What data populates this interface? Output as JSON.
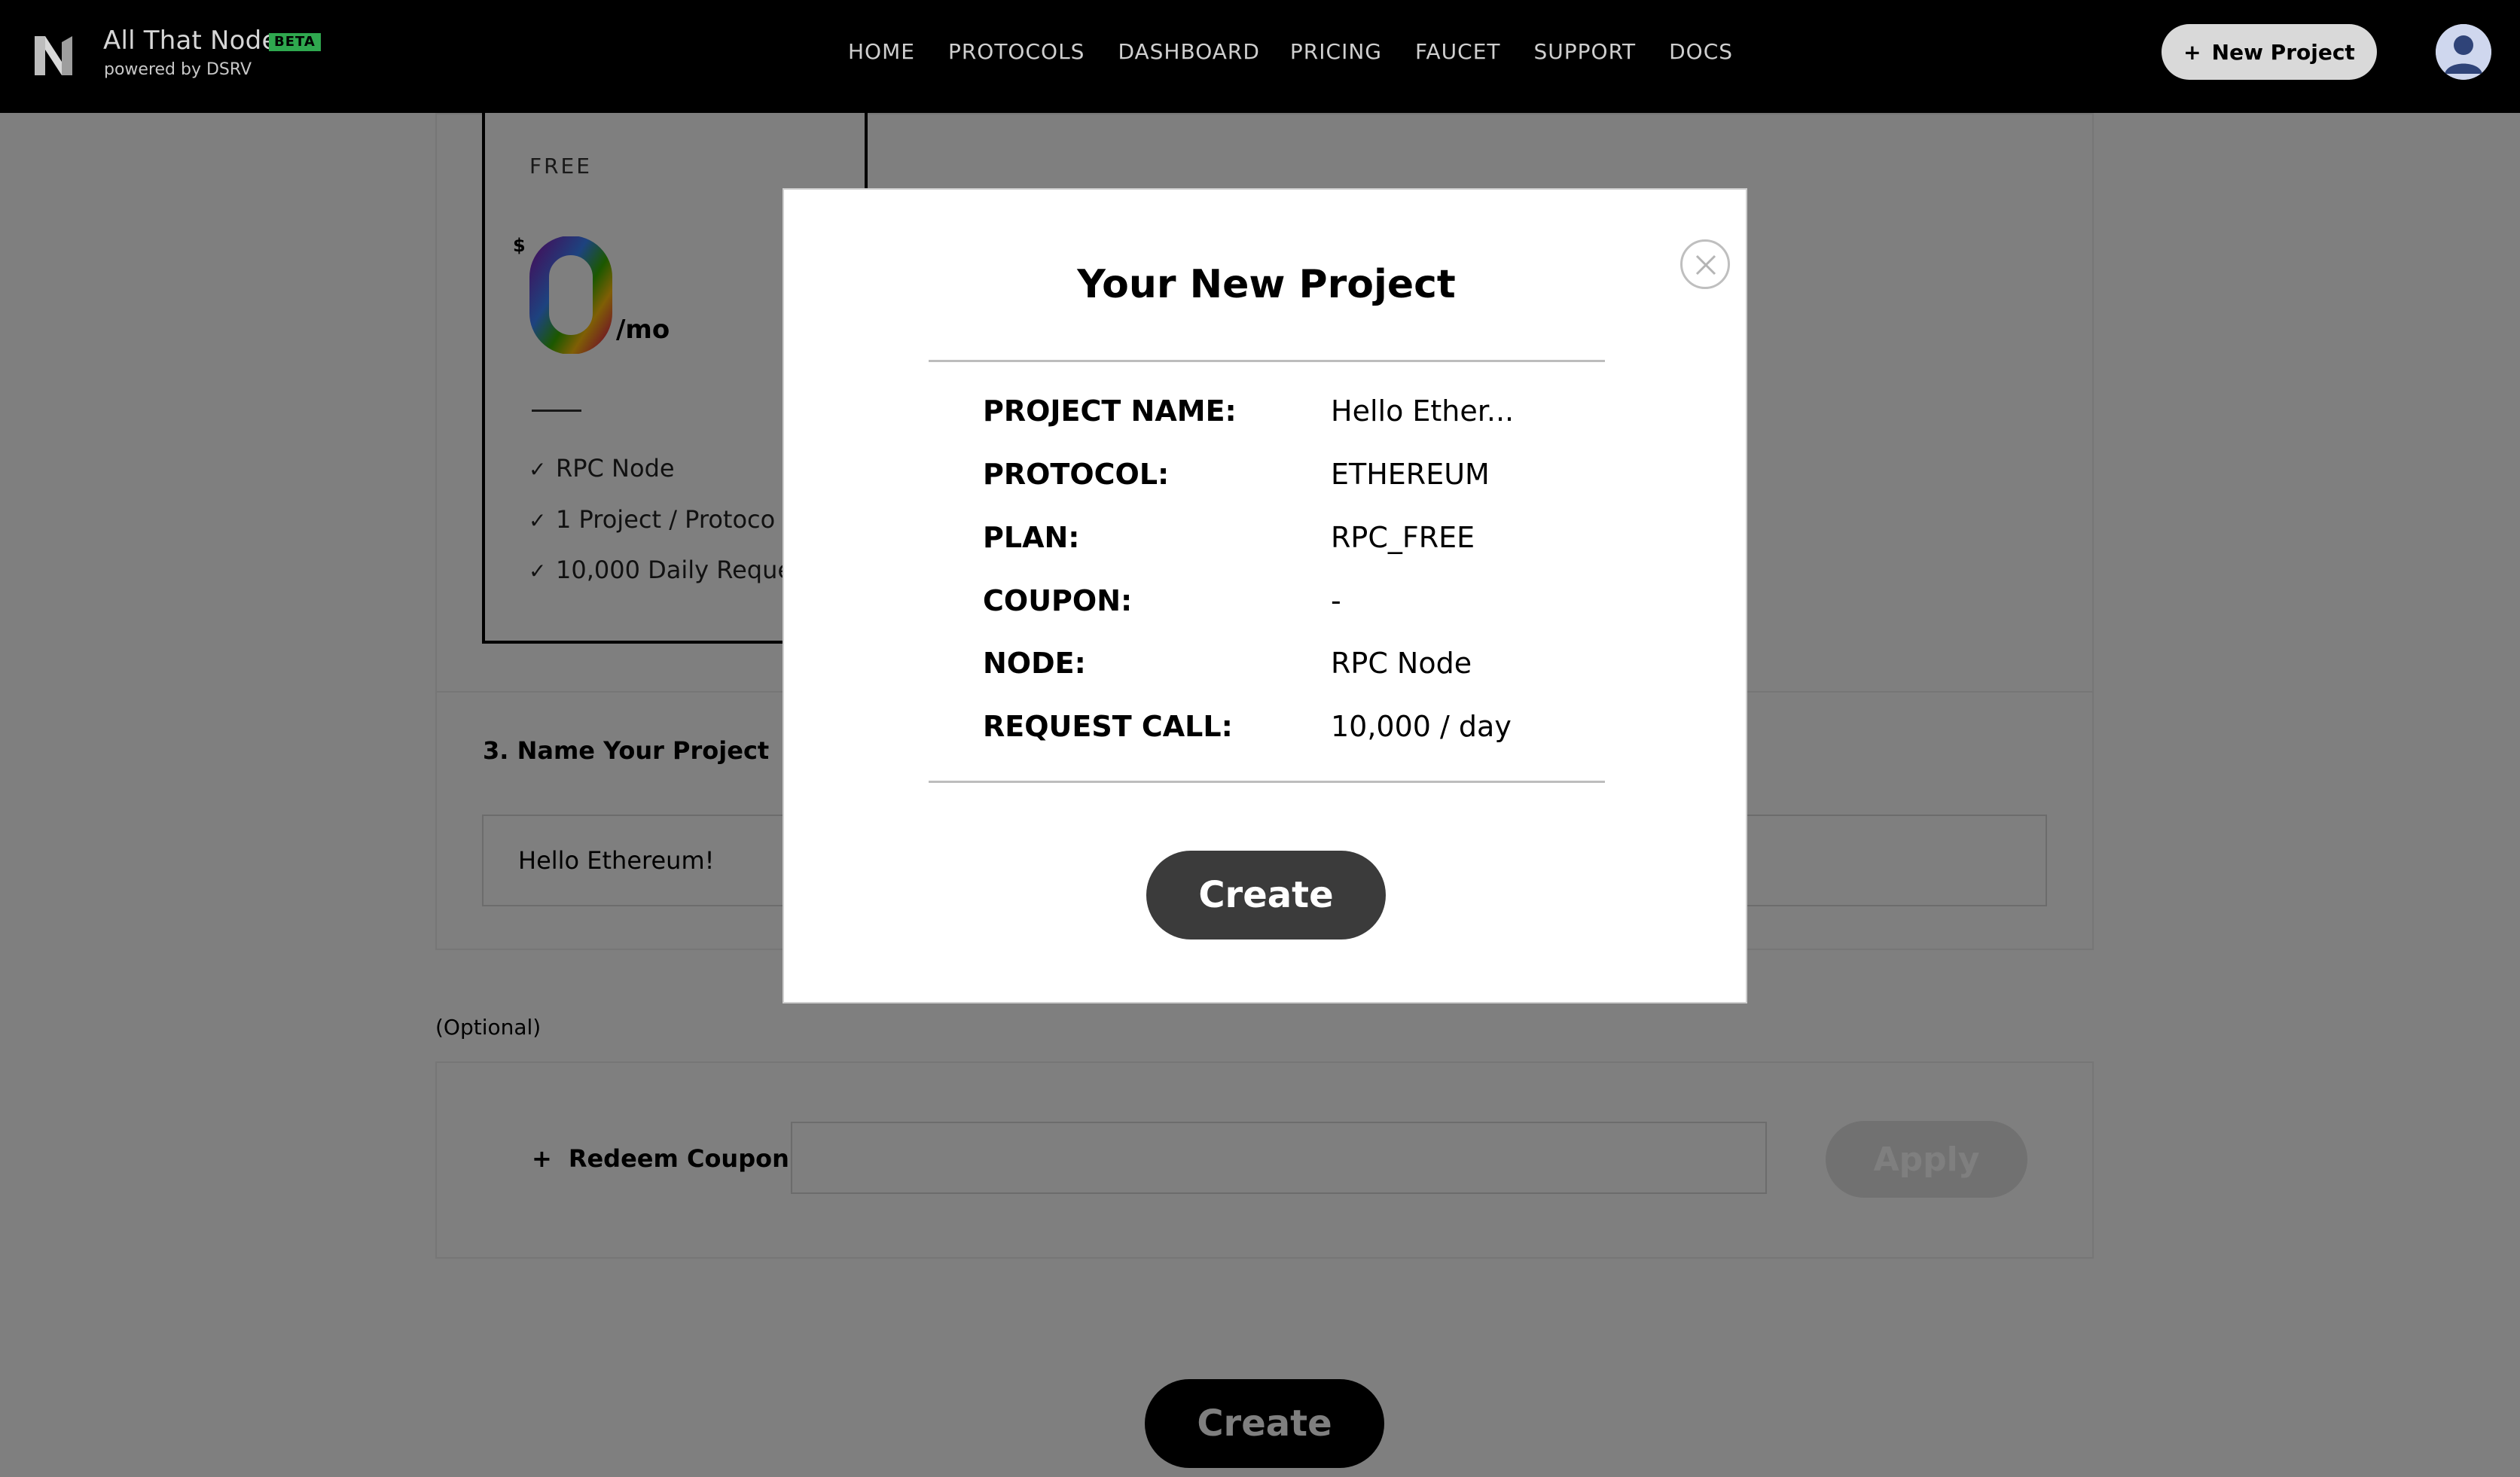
{
  "nav": {
    "brand_name": "All That Node",
    "beta_badge": "BETA",
    "brand_sub": "powered by DSRV",
    "links": [
      "HOME",
      "PROTOCOLS",
      "DASHBOARD",
      "PRICING",
      "FAUCET",
      "SUPPORT",
      "DOCS"
    ],
    "new_project_plus": "+",
    "new_project_label": "New Project"
  },
  "plan": {
    "tier": "FREE",
    "currency": "$",
    "price": "0",
    "period": "/mo",
    "features": [
      "RPC Node",
      "1 Project / Protoco",
      "10,000 Daily Reque"
    ],
    "check_glyph": "✓"
  },
  "name_section": {
    "title": "3. Name Your Project",
    "input_value": "Hello Ethereum!"
  },
  "coupon_section": {
    "optional_label": "(Optional)",
    "redeem_plus": "+",
    "redeem_label": "Redeem Coupon",
    "input_value": "",
    "apply_label": "Apply"
  },
  "bottom_create_label": "Create",
  "modal": {
    "title": "Your New Project",
    "rows": [
      {
        "label": "PROJECT NAME:",
        "value": "Hello Ether..."
      },
      {
        "label": "PROTOCOL:",
        "value": "ETHEREUM"
      },
      {
        "label": "PLAN:",
        "value": "RPC_FREE"
      },
      {
        "label": "COUPON:",
        "value": "-"
      },
      {
        "label": "NODE:",
        "value": "RPC Node"
      },
      {
        "label": "REQUEST CALL:",
        "value": "10,000 / day"
      }
    ],
    "create_label": "Create"
  },
  "colors": {
    "navbar": "#000000",
    "beta_badge": "#2fa84f",
    "overlay": "rgba(0,0,0,0.5)",
    "modal_create_button": "#3b3b3b"
  },
  "icons": {
    "logo": "all-that-node-logo",
    "avatar": "user-avatar-icon",
    "close": "close-icon",
    "check": "check-icon",
    "plus": "plus-icon"
  }
}
